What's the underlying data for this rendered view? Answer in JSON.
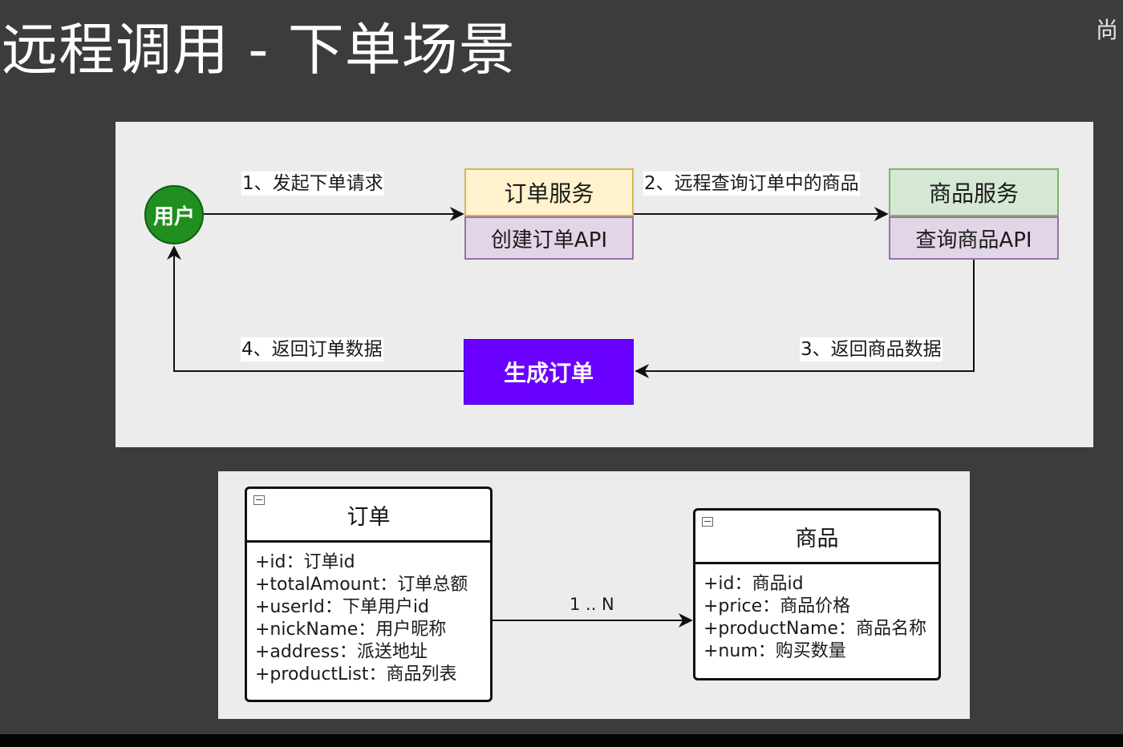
{
  "title": "远程调用 - 下单场景",
  "corner_text": "尚",
  "flow": {
    "user": "用户",
    "order_service": {
      "name": "订单服务",
      "api": "创建订单API"
    },
    "product_service": {
      "name": "商品服务",
      "api": "查询商品API"
    },
    "generate": "生成订单",
    "steps": [
      "1、发起下单请求",
      "2、远程查询订单中的商品",
      "3、返回商品数据",
      "4、返回订单数据"
    ]
  },
  "classes": {
    "order": {
      "name": "订单",
      "fields": [
        "+id：订单id",
        "+totalAmount：订单总额",
        "+userId：下单用户id",
        "+nickName：用户昵称",
        "+address：派送地址",
        "+productList：商品列表"
      ]
    },
    "product": {
      "name": "商品",
      "fields": [
        "+id：商品id",
        "+price：商品价格",
        "+productName：商品名称",
        "+num：购买数量"
      ]
    },
    "relation": "1 .. N"
  },
  "colors": {
    "user": "#1f8f1f",
    "order_service": "#fff2cc",
    "product_service": "#d5e8d4",
    "api": "#e1d5e7",
    "generate": "#6a00ff"
  }
}
